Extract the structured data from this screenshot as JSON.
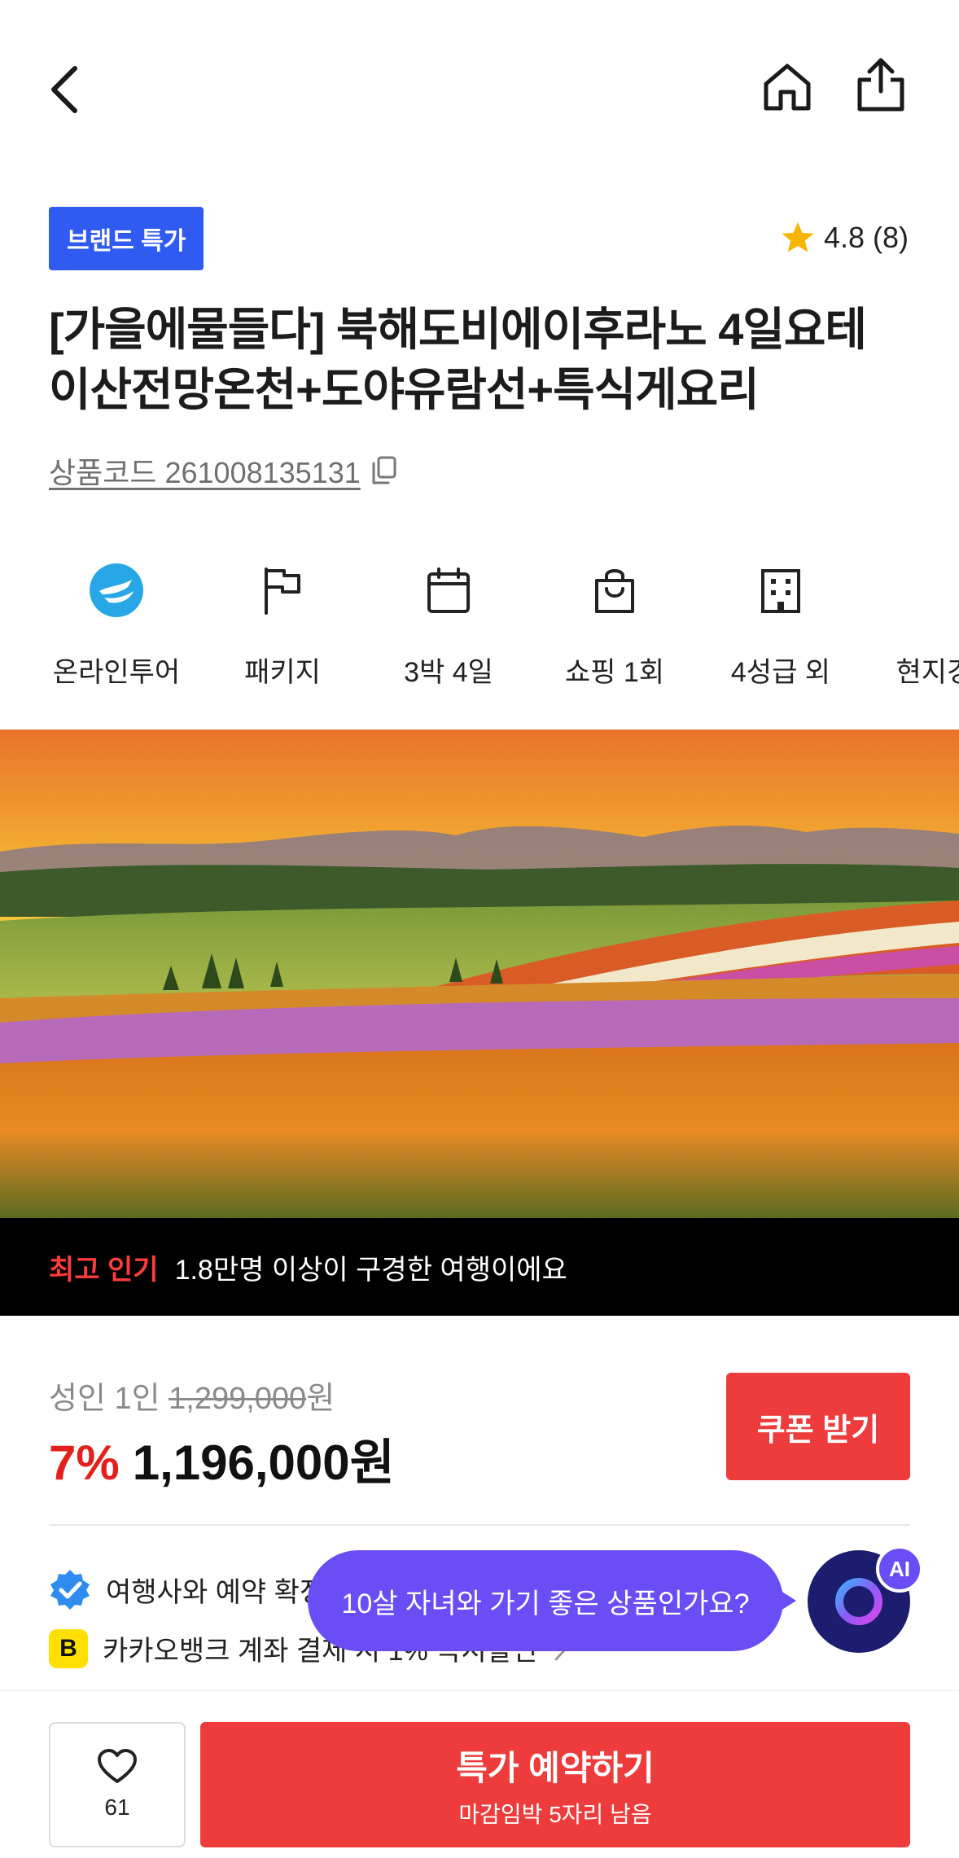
{
  "header": {
    "back_icon": "chevron-left-icon",
    "home_icon": "home-icon",
    "share_icon": "share-icon"
  },
  "product": {
    "badge": "브랜드 특가",
    "rating": "4.8 (8)",
    "title_line1": "[가을에물들다] 북해도비에이후라노 4일요테",
    "title_line2": "이산전망온천+도야유람선+특식게요리",
    "code_label": "상품코드 261008135131"
  },
  "info_items": [
    {
      "icon": "airline-logo-icon",
      "label": "온라인투어"
    },
    {
      "icon": "flag-icon",
      "label": "패키지"
    },
    {
      "icon": "calendar-icon",
      "label": "3박 4일"
    },
    {
      "icon": "shopping-bag-icon",
      "label": "쇼핑 1회"
    },
    {
      "icon": "hotel-icon",
      "label": "4성급 외"
    },
    {
      "icon": "tour-icon",
      "label": "현지경비"
    }
  ],
  "popular": {
    "tag": "최고 인기",
    "message": "1.8만명 이상이 구경한 여행이에요"
  },
  "price": {
    "orig_prefix": "성인 1인 ",
    "orig_price": "1,299,000",
    "orig_suffix": "원",
    "discount": "7%",
    "final_price": "1,196,000원",
    "coupon_label": "쿠폰 받기"
  },
  "benefits": [
    {
      "icon": "verified-check-icon",
      "text": "여행사와 예약 확정"
    },
    {
      "icon": "kakaobank-icon",
      "badge": "B",
      "text": "카카오뱅크 계좌 결제 시 1% 즉시할인"
    }
  ],
  "ai": {
    "question": "10살 자녀와 가기 좋은 상품인가요?",
    "badge": "AI"
  },
  "bottom": {
    "wish_count": "61",
    "book_label": "특가 예약하기",
    "book_sub": "마감임박 5자리 남음"
  },
  "colors": {
    "brand_blue": "#2f5bf0",
    "cta_red": "#ee3b3b",
    "discount_red": "#e3211c",
    "ai_purple": "#6b4df5",
    "star": "#f7b500"
  }
}
